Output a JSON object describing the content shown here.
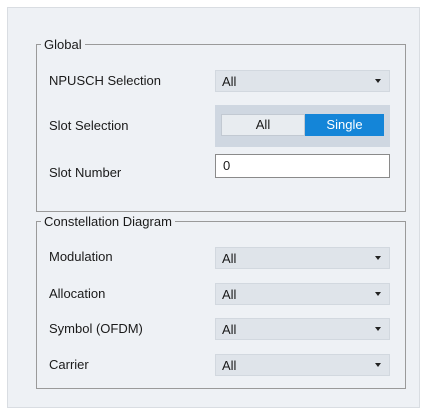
{
  "global": {
    "title": "Global",
    "npusch_selection": {
      "label": "NPUSCH Selection",
      "value": "All"
    },
    "slot_selection": {
      "label": "Slot Selection",
      "options": [
        "All",
        "Single"
      ],
      "selected": "Single"
    },
    "slot_number": {
      "label": "Slot Number",
      "value": "0"
    }
  },
  "constellation": {
    "title": "Constellation Diagram",
    "modulation": {
      "label": "Modulation",
      "value": "All"
    },
    "allocation": {
      "label": "Allocation",
      "value": "All"
    },
    "symbol": {
      "label": "Symbol (OFDM)",
      "value": "All"
    },
    "carrier": {
      "label": "Carrier",
      "value": "All"
    }
  },
  "colors": {
    "accent": "#1485d8",
    "panel_bg": "#eef1f5",
    "combo_bg": "#dfe4ea"
  },
  "icons": {
    "dropdown": "chevron-down-icon"
  }
}
